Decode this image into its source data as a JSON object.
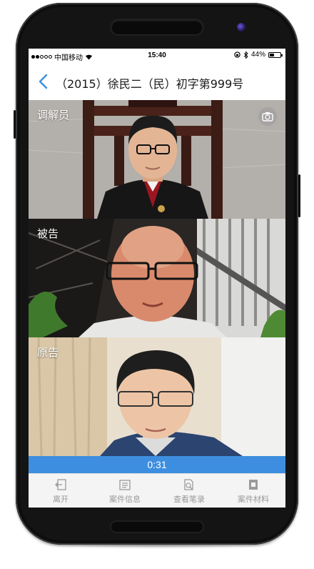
{
  "status_bar": {
    "carrier": "中国移动",
    "time": "15:40",
    "battery": "44%",
    "battery_level": 0.44
  },
  "nav": {
    "title": "（2015）徐民二（民）初字第999号"
  },
  "panels": [
    {
      "role": "调解员"
    },
    {
      "role": "被告"
    },
    {
      "role": "原告"
    }
  ],
  "call": {
    "timer": "0:31"
  },
  "tabs": [
    {
      "label": "离开",
      "icon": "exit-icon"
    },
    {
      "label": "案件信息",
      "icon": "case-info-icon"
    },
    {
      "label": "查看笔录",
      "icon": "view-record-icon"
    },
    {
      "label": "案件材料",
      "icon": "case-material-icon"
    }
  ],
  "colors": {
    "accent": "#3d8ee0",
    "tab_text": "#9a9a9a"
  }
}
